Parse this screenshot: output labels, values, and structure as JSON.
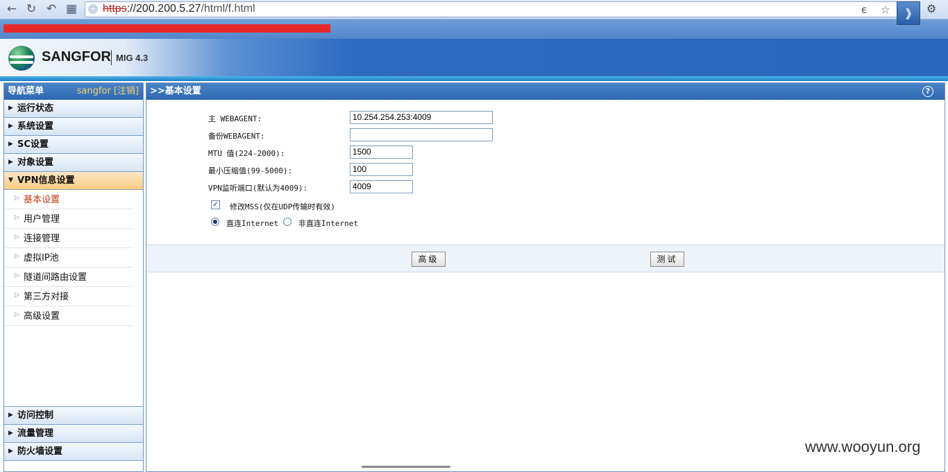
{
  "browser": {
    "url_scheme": "https",
    "url_host": "://200.200.5.27",
    "url_path": "/html/f.html"
  },
  "header": {
    "brand": "SANGFOR",
    "model": "MIG 4.3"
  },
  "sidebar": {
    "title": "导航菜单",
    "user": "sangfor [注销]",
    "sections_top": [
      {
        "label": "运行状态"
      },
      {
        "label": "系统设置"
      },
      {
        "label": "SC设置"
      },
      {
        "label": "对象设置"
      }
    ],
    "active_section": {
      "label": "VPN信息设置"
    },
    "sub_items": [
      {
        "label": "基本设置"
      },
      {
        "label": "用户管理"
      },
      {
        "label": "连接管理"
      },
      {
        "label": "虚拟IP池"
      },
      {
        "label": "隧道间路由设置"
      },
      {
        "label": "第三方对接"
      },
      {
        "label": "高级设置"
      }
    ],
    "sections_bottom": [
      {
        "label": "访问控制"
      },
      {
        "label": "流量管理"
      },
      {
        "label": "防火墙设置"
      }
    ]
  },
  "main": {
    "title": ">>基本设置",
    "fields": {
      "primary_label": "主  WEBAGENT:",
      "primary_value": "10.254.254.253:4009",
      "backup_label": "备份WEBAGENT:",
      "backup_value": "",
      "mtu_label": "MTU 值(224-2000):",
      "mtu_value": "1500",
      "compress_label": "最小压缩值(99-5000):",
      "compress_value": "100",
      "port_label": "VPN监听端口(默认为4009):",
      "port_value": "4009"
    },
    "mss_label": "修改MSS(仅在UDP传输时有效)",
    "mss_checked": true,
    "radio_direct": "直连Internet",
    "radio_indirect": "非直连Internet",
    "radio_selected": "直连Internet",
    "buttons": {
      "advanced": "高级",
      "test": "测试"
    }
  },
  "watermark": "www.wooyun.org",
  "colors": {
    "title_bar": "#2d68b1",
    "active_section": "#f8cc85",
    "current_item": "#c23a10"
  }
}
